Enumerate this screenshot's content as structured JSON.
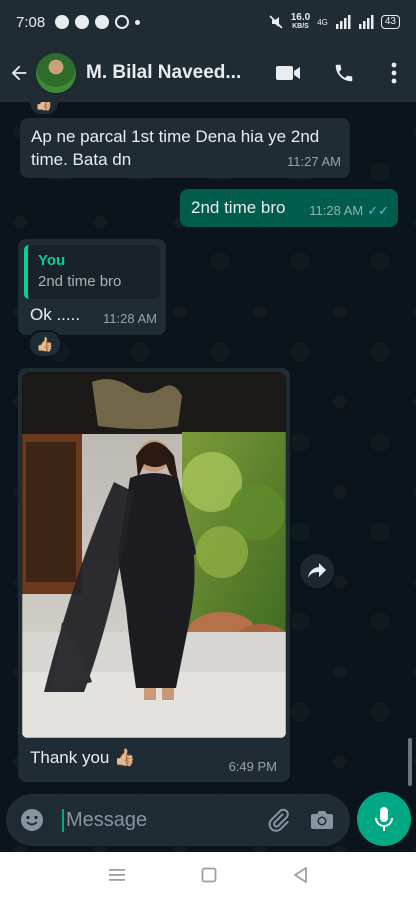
{
  "status_bar": {
    "time": "7:08",
    "net_speed_value": "16.0",
    "net_speed_unit": "KB/S",
    "network_type": "4G",
    "battery": "43"
  },
  "header": {
    "contact_name": "M. Bilal Naveed..."
  },
  "messages": [
    {
      "direction": "incoming",
      "text": "Ap ne parcal 1st time Dena hia ye 2nd time.  Bata dn",
      "time": "11:27 AM"
    },
    {
      "direction": "outgoing",
      "text": "2nd time bro",
      "time": "11:28 AM",
      "status": "read"
    },
    {
      "direction": "incoming",
      "quote_author": "You",
      "quote_text": "2nd time bro",
      "text": "Ok .....",
      "time": "11:28 AM",
      "reaction": "👍🏼"
    },
    {
      "direction": "incoming",
      "type": "image",
      "caption": "Thank you 👍🏼",
      "time": "6:49 PM"
    }
  ],
  "composer": {
    "placeholder": "Message"
  },
  "colors": {
    "header_bg": "#1f2c34",
    "chat_bg": "#0b141a",
    "incoming_bubble": "#1f2c34",
    "outgoing_bubble": "#005c4b",
    "accent": "#00a884",
    "read_ticks": "#53bdeb"
  },
  "icons": {
    "back": "arrow-left-icon",
    "video": "video-camera-icon",
    "call": "phone-icon",
    "menu": "more-vert-icon",
    "emoji": "emoji-icon",
    "attach": "paperclip-icon",
    "camera": "camera-icon",
    "mic": "mic-icon",
    "forward": "forward-icon"
  }
}
